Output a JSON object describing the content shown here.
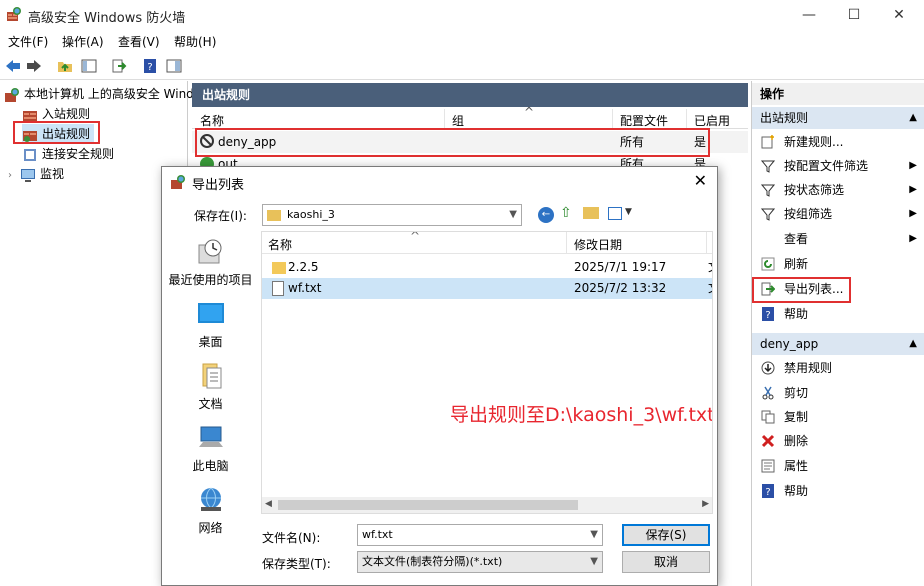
{
  "window": {
    "title": "高级安全 Windows 防火墙",
    "minimize": "—",
    "maximize": "☐",
    "close": "✕"
  },
  "menu": [
    "文件(F)",
    "操作(A)",
    "查看(V)",
    "帮助(H)"
  ],
  "tree": {
    "root": "本地计算机 上的高级安全 Windows",
    "items": [
      "入站规则",
      "出站规则",
      "连接安全规则",
      "监视"
    ]
  },
  "middle": {
    "header": "出站规则",
    "columns": [
      "名称",
      "组",
      "配置文件",
      "已启用"
    ],
    "rows": [
      {
        "name": "deny_app",
        "group": "",
        "profile": "所有",
        "enabled": "是"
      },
      {
        "name": "out",
        "group": "",
        "profile": "所有",
        "enabled": "是"
      }
    ]
  },
  "actions": {
    "title": "操作",
    "section1": "出站规则",
    "section1_items": [
      "新建规则...",
      "按配置文件筛选",
      "按状态筛选",
      "按组筛选",
      "查看",
      "刷新",
      "导出列表...",
      "帮助"
    ],
    "section2": "deny_app",
    "section2_items": [
      "禁用规则",
      "剪切",
      "复制",
      "删除",
      "属性",
      "帮助"
    ]
  },
  "dialog": {
    "title": "导出列表",
    "save_in_label": "保存在(I):",
    "save_in_value": "kaoshi_3",
    "places": [
      "最近使用的项目",
      "桌面",
      "文档",
      "此电脑",
      "网络"
    ],
    "columns": [
      "名称",
      "修改日期"
    ],
    "files": [
      {
        "name": "2.2.5",
        "date": "2025/7/1 19:17",
        "type": "文"
      },
      {
        "name": "wf.txt",
        "date": "2025/7/2 13:32",
        "type": "文"
      }
    ],
    "filename_label": "文件名(N):",
    "filename_value": "wf.txt",
    "filetype_label": "保存类型(T):",
    "filetype_value": "文本文件(制表符分隔)(*.txt)",
    "save_button": "保存(S)",
    "cancel_button": "取消"
  },
  "annotation": "导出规则至D:\\kaoshi_3\\wf.txt",
  "colors": {
    "highlight_red": "#e03030",
    "pane_header": "#4a5f7a",
    "action_section": "#dbe6f2",
    "selection": "#cce4f7"
  }
}
